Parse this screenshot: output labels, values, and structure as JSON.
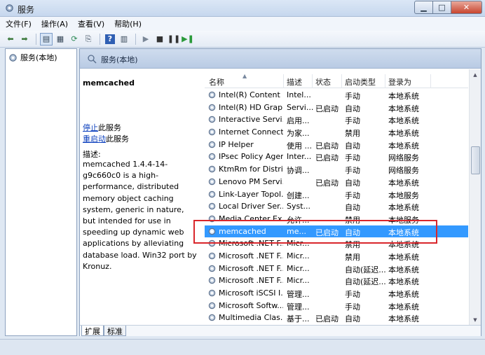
{
  "window": {
    "title": "服务"
  },
  "menu": [
    "文件(F)",
    "操作(A)",
    "查看(V)",
    "帮助(H)"
  ],
  "toolbar": {
    "icons": [
      "back-icon",
      "forward-icon",
      "console-tree-icon",
      "properties-icon",
      "refresh-icon",
      "export-icon",
      "help-icon",
      "action-pane-icon",
      "start-service-icon",
      "stop-service-icon",
      "pause-service-icon",
      "restart-service-icon"
    ]
  },
  "tree": {
    "root_label": "服务(本地)"
  },
  "right_header": {
    "title": "服务(本地)"
  },
  "details": {
    "service_name": "memcached",
    "stop_link": "停止",
    "stop_suffix": "此服务",
    "restart_link": "重启动",
    "restart_suffix": "此服务",
    "desc_label": "描述:",
    "desc_text": "memcached 1.4.4-14-g9c660c0 is a high-performance, distributed memory object caching system, generic in nature, but intended for use in speeding up dynamic web applications by alleviating database load. Win32 port by Kronuz."
  },
  "columns": {
    "name": "名称",
    "desc": "描述",
    "status": "状态",
    "startup": "启动类型",
    "logon": "登录为"
  },
  "rows": [
    {
      "name": "Intel(R) Content ...",
      "desc": "Intel...",
      "status": "",
      "startup": "手动",
      "logon": "本地系统"
    },
    {
      "name": "Intel(R) HD Grap...",
      "desc": "Servi...",
      "status": "已启动",
      "startup": "自动",
      "logon": "本地系统"
    },
    {
      "name": "Interactive Servi...",
      "desc": "启用...",
      "status": "",
      "startup": "手动",
      "logon": "本地系统"
    },
    {
      "name": "Internet Connect...",
      "desc": "为家...",
      "status": "",
      "startup": "禁用",
      "logon": "本地系统"
    },
    {
      "name": "IP Helper",
      "desc": "使用 ...",
      "status": "已启动",
      "startup": "自动",
      "logon": "本地系统"
    },
    {
      "name": "IPsec Policy Agent",
      "desc": "Inter...",
      "status": "已启动",
      "startup": "手动",
      "logon": "网络服务"
    },
    {
      "name": "KtmRm for Distri...",
      "desc": "协调...",
      "status": "",
      "startup": "手动",
      "logon": "网络服务"
    },
    {
      "name": "Lenovo PM Servi...",
      "desc": "",
      "status": "已启动",
      "startup": "自动",
      "logon": "本地系统"
    },
    {
      "name": "Link-Layer Topol...",
      "desc": "创建...",
      "status": "",
      "startup": "手动",
      "logon": "本地服务"
    },
    {
      "name": "Local Driver Ser...",
      "desc": "Syst...",
      "status": "",
      "startup": "自动",
      "logon": "本地系统"
    },
    {
      "name": "Media Center Ex...",
      "desc": "允许...",
      "status": "",
      "startup": "禁用",
      "logon": "本地服务"
    },
    {
      "name": "memcached",
      "desc": "me...",
      "status": "已启动",
      "startup": "自动",
      "logon": "本地系统",
      "selected": true
    },
    {
      "name": "Microsoft .NET F...",
      "desc": "Micr...",
      "status": "",
      "startup": "禁用",
      "logon": "本地系统"
    },
    {
      "name": "Microsoft .NET F...",
      "desc": "Micr...",
      "status": "",
      "startup": "禁用",
      "logon": "本地系统"
    },
    {
      "name": "Microsoft .NET F...",
      "desc": "Micr...",
      "status": "",
      "startup": "自动(延迟...",
      "logon": "本地系统"
    },
    {
      "name": "Microsoft .NET F...",
      "desc": "Micr...",
      "status": "",
      "startup": "自动(延迟...",
      "logon": "本地系统"
    },
    {
      "name": "Microsoft iSCSI I...",
      "desc": "管理...",
      "status": "",
      "startup": "手动",
      "logon": "本地系统"
    },
    {
      "name": "Microsoft Softw...",
      "desc": "管理...",
      "status": "",
      "startup": "手动",
      "logon": "本地系统"
    },
    {
      "name": "Multimedia Clas...",
      "desc": "基于...",
      "status": "已启动",
      "startup": "自动",
      "logon": "本地系统"
    }
  ],
  "tabs": [
    "扩展",
    "标准"
  ],
  "colors": {
    "selection": "#3399ff",
    "highlight_box": "#d9262b",
    "link": "#0b3fbd"
  }
}
